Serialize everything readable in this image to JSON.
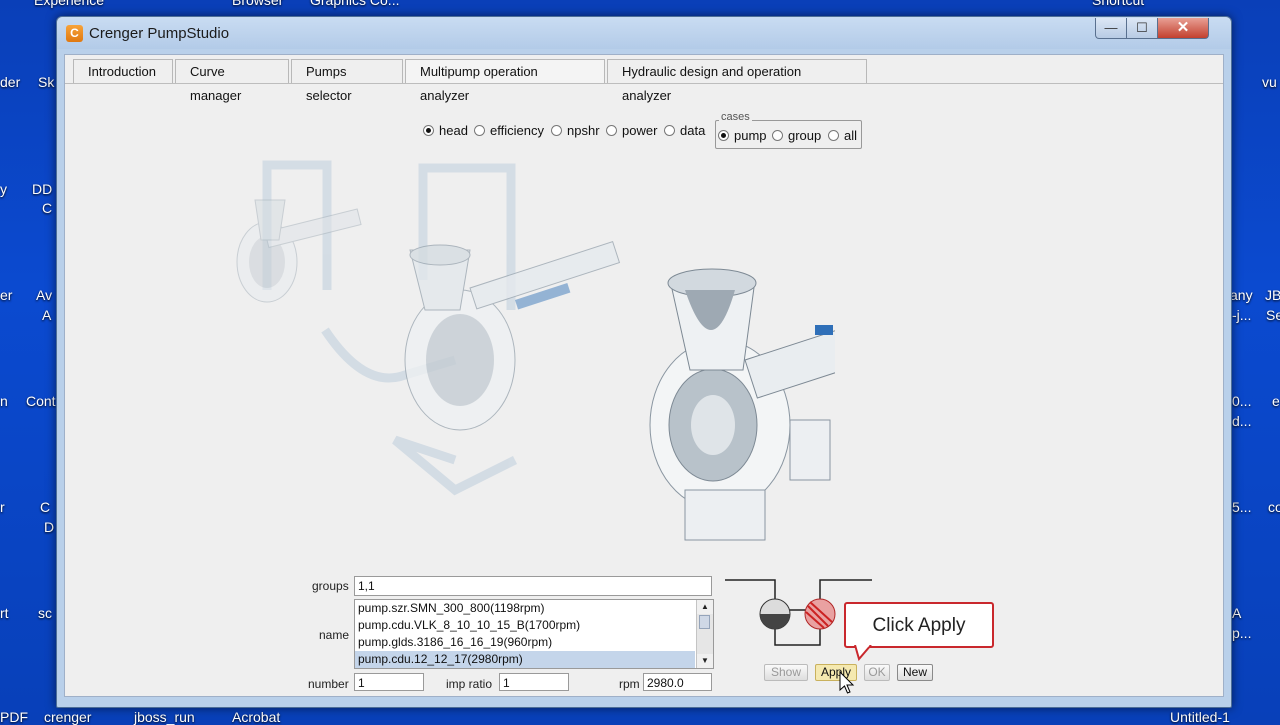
{
  "desktop": {
    "labels": [
      "Experience",
      "Browser",
      "Graphics Co...",
      "Shortcut",
      "der",
      "Sk",
      "vu",
      "y",
      "DD",
      "C",
      "er",
      "Av",
      "A",
      "any",
      "JB",
      "-j...",
      "Se",
      "n",
      "Cont",
      "0...",
      "d...",
      "e",
      "r",
      "C",
      "D",
      "5...",
      "co",
      "rt",
      "sc",
      "A",
      "p...",
      "PDF",
      "crenger",
      "jboss_run",
      "Acrobat",
      "Untitled-1"
    ]
  },
  "window": {
    "title": "Crenger PumpStudio",
    "controls": {
      "minimize": "—",
      "maximize": "☐",
      "close": "✕"
    }
  },
  "tabs": [
    {
      "label": "Introduction"
    },
    {
      "label": "Curve manager"
    },
    {
      "label": "Pumps selector"
    },
    {
      "label": "Multipump operation analyzer"
    },
    {
      "label": "Hydraulic design and operation analyzer"
    }
  ],
  "plot_options": {
    "items": [
      {
        "label": "head",
        "checked": true
      },
      {
        "label": "efficiency",
        "checked": false
      },
      {
        "label": "npshr",
        "checked": false
      },
      {
        "label": "power",
        "checked": false
      },
      {
        "label": "data",
        "checked": false
      }
    ]
  },
  "cases": {
    "legend": "cases",
    "items": [
      {
        "label": "pump",
        "checked": true
      },
      {
        "label": "group",
        "checked": false
      },
      {
        "label": "all",
        "checked": false
      }
    ]
  },
  "form": {
    "groups_label": "groups",
    "groups_value": "1,1",
    "name_label": "name",
    "names": [
      "pump.szr.SMN_300_800(1198rpm)",
      "pump.cdu.VLK_8_10_10_15_B(1700rpm)",
      "pump.glds.3186_16_16_19(960rpm)",
      "pump.cdu.12_12_17(2980rpm)"
    ],
    "number_label": "number",
    "number_value": "1",
    "imp_ratio_label": "imp ratio",
    "imp_ratio_value": "1",
    "rpm_label": "rpm",
    "rpm_value": "2980.0"
  },
  "buttons": {
    "show": "Show",
    "apply": "Apply",
    "ok": "OK",
    "new": "New"
  },
  "callout": "Click Apply",
  "colors": {
    "desktop_blue": "#0b4ad0",
    "callout_border": "#c9282d",
    "selection": "#c4d5ea"
  }
}
